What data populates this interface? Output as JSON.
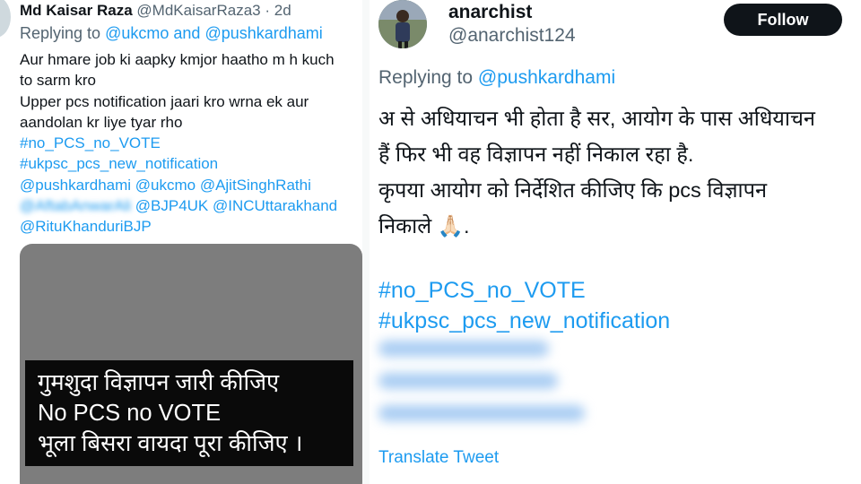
{
  "left_tweet": {
    "name": "Md Kaisar Raza",
    "handle": "@MdKaisarRaza3",
    "separator": "·",
    "time": "2d",
    "reply_prefix": "Replying to",
    "reply_user1": "@ukcmo",
    "reply_and": "and",
    "reply_user2": "@pushkardhami",
    "lines": [
      "Aur hmare job ki aapky kmjor haatho m h kuch",
      "to sarm kro",
      "Upper pcs notification jaari kro wrna ek aur",
      "aandolan kr liye tyar rho"
    ],
    "hashtag1": "#no_PCS_no_VOTE",
    "hashtag2": "#ukpsc_pcs_new_notification",
    "mentions_line1": "@pushkardhami @ukcmo @AjitSinghRathi",
    "mentions_line2_blurred": "@AftabAnwarAli",
    "mentions_line2_rest": "@BJP4UK @INCUttarakhand",
    "mentions_line3": "@RituKhanduriBJP",
    "media_text": [
      "गुमशुदा विज्ञापन जारी कीजिए",
      "No PCS no VOTE",
      "भूला बिसरा वायदा पूरा कीजिए ।"
    ]
  },
  "right_tweet": {
    "name": "anarchist",
    "handle": "@anarchist124",
    "follow_label": "Follow",
    "reply_prefix": "Replying to",
    "reply_user": "@pushkardhami",
    "body_lines": [
      "अ से अधियाचन भी होता है सर, आयोग के पास अधियाचन",
      "हैं फिर भी वह विज्ञापन नहीं निकाल रहा है.",
      "कृपया आयोग को निर्देशित कीजिए कि pcs विज्ञापन",
      "निकाले 🙏🏻."
    ],
    "hashtag1": "#no_PCS_no_VOTE",
    "hashtag2": "#ukpsc_pcs_new_notification",
    "translate_label": "Translate Tweet"
  },
  "colors": {
    "link": "#1d9bf0",
    "muted": "#536471",
    "text": "#0f1419",
    "follow_bg": "#0f1419"
  }
}
